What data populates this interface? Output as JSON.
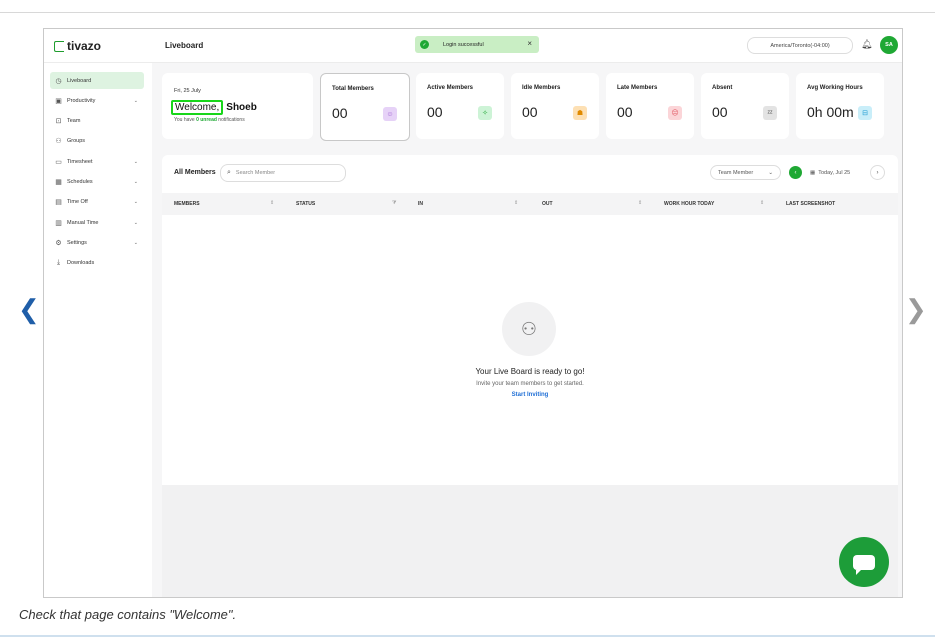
{
  "app": {
    "logo_text": "tivazo",
    "page_title": "Liveboard",
    "toast": {
      "text": "Login successful",
      "close": "×"
    },
    "timezone": "America/Toronto(-04:00)",
    "avatar_initials": "SA"
  },
  "sidebar": {
    "items": [
      {
        "label": "Liveboard",
        "icon": "liveboard-icon",
        "glyph": "◷",
        "chevron": false,
        "active": true
      },
      {
        "label": "Productivity",
        "icon": "productivity-icon",
        "glyph": "▣",
        "chevron": true,
        "active": false
      },
      {
        "label": "Team",
        "icon": "team-icon",
        "glyph": "⊡",
        "chevron": false,
        "active": false
      },
      {
        "label": "Groups",
        "icon": "groups-icon",
        "glyph": "⚇",
        "chevron": false,
        "active": false
      },
      {
        "label": "Timesheet",
        "icon": "timesheet-icon",
        "glyph": "▭",
        "chevron": true,
        "active": false
      },
      {
        "label": "Schedules",
        "icon": "schedules-icon",
        "glyph": "▦",
        "chevron": true,
        "active": false
      },
      {
        "label": "Time Off",
        "icon": "time-off-icon",
        "glyph": "▤",
        "chevron": true,
        "active": false
      },
      {
        "label": "Manual Time",
        "icon": "manual-time-icon",
        "glyph": "▥",
        "chevron": true,
        "active": false
      },
      {
        "label": "Settings",
        "icon": "settings-icon",
        "glyph": "⚙",
        "chevron": true,
        "active": false
      },
      {
        "label": "Downloads",
        "icon": "downloads-icon",
        "glyph": "⤓",
        "chevron": false,
        "active": false
      }
    ]
  },
  "welcome": {
    "date": "Fri, 25 July",
    "greeting": "Welcome,",
    "name": "Shoeb",
    "notif_prefix": "You have",
    "notif_count": "0",
    "notif_unread": "unread",
    "notif_suffix": "notifications"
  },
  "stats": [
    {
      "label": "Total Members",
      "value": "00",
      "icon": "users-icon",
      "glyph": "☺",
      "bg": "#e6d2f7",
      "fg": "#9b59d0"
    },
    {
      "label": "Active Members",
      "value": "00",
      "icon": "active-icon",
      "glyph": "✧",
      "bg": "#cdf3d6",
      "fg": "#1fa834"
    },
    {
      "label": "Idle Members",
      "value": "00",
      "icon": "idle-icon",
      "glyph": "☗",
      "bg": "#fde0b4",
      "fg": "#e08a00"
    },
    {
      "label": "Late Members",
      "value": "00",
      "icon": "late-icon",
      "glyph": "☹",
      "bg": "#fbd5d8",
      "fg": "#e0525e"
    },
    {
      "label": "Absent",
      "value": "00",
      "icon": "absent-icon",
      "glyph": "ᶻᶻ",
      "bg": "#e3e3e3",
      "fg": "#444"
    },
    {
      "label": "Avg Working Hours",
      "value": "0h 00m",
      "icon": "briefcase-icon",
      "glyph": "⊟",
      "bg": "#c9eef9",
      "fg": "#1d9bd1"
    }
  ],
  "members_panel": {
    "title": "All Members",
    "search_placeholder": "Search Member",
    "filter_label": "Team Member",
    "date_label": "Today, Jul 25",
    "columns": [
      "MEMBERS",
      "STATUS",
      "IN",
      "OUT",
      "WORK HOUR TODAY",
      "LAST SCREENSHOT"
    ],
    "empty": {
      "title": "Your Live Board is ready to go!",
      "subtitle": "Invite your team members to get started.",
      "link": "Start Inviting"
    }
  },
  "caption": "Check that page contains \"Welcome\".",
  "colors": {
    "brand_green": "#1fa834",
    "highlight_box": "#18d61a",
    "link_blue": "#1f6fd6"
  }
}
